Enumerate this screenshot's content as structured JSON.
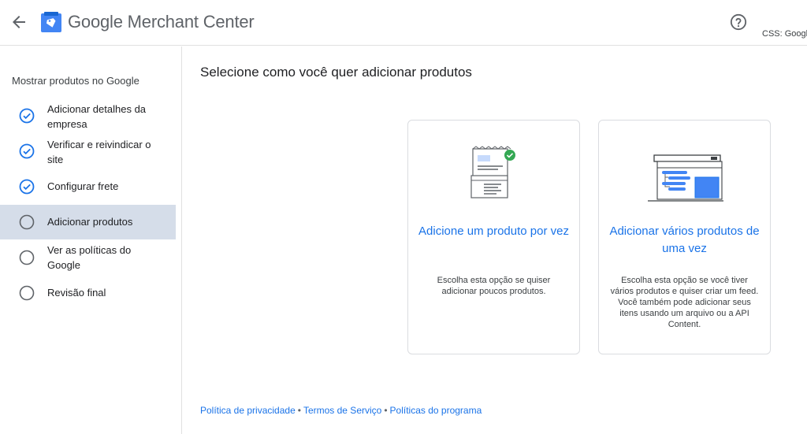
{
  "header": {
    "brand": "Google",
    "product": "Merchant Center",
    "css_label": "CSS: Googl"
  },
  "sidebar": {
    "title": "Mostrar produtos no Google",
    "steps": [
      {
        "label": "Adicionar detalhes da empresa",
        "status": "done"
      },
      {
        "label": "Verificar e reivindicar o site",
        "status": "done"
      },
      {
        "label": "Configurar frete",
        "status": "done"
      },
      {
        "label": "Adicionar produtos",
        "status": "current"
      },
      {
        "label": "Ver as políticas do Google",
        "status": "pending"
      },
      {
        "label": "Revisão final",
        "status": "pending"
      }
    ]
  },
  "main": {
    "title": "Selecione como você quer adicionar produtos",
    "cards": [
      {
        "title": "Adicione um produto por vez",
        "description": "Escolha esta opção se quiser adicionar poucos produtos."
      },
      {
        "title": "Adicionar vários produtos de uma vez",
        "description": "Escolha esta opção se você tiver vários produtos e quiser criar um feed. Você também pode adicionar seus itens usando um arquivo ou a API Content."
      }
    ]
  },
  "footer": {
    "links": [
      "Política de privacidade",
      "Termos de Serviço",
      "Políticas do programa"
    ]
  },
  "colors": {
    "accent": "#1a73e8",
    "active_step_bg": "#d5dde9",
    "check_done": "#1a73e8",
    "pending_circle": "#5f6368"
  }
}
